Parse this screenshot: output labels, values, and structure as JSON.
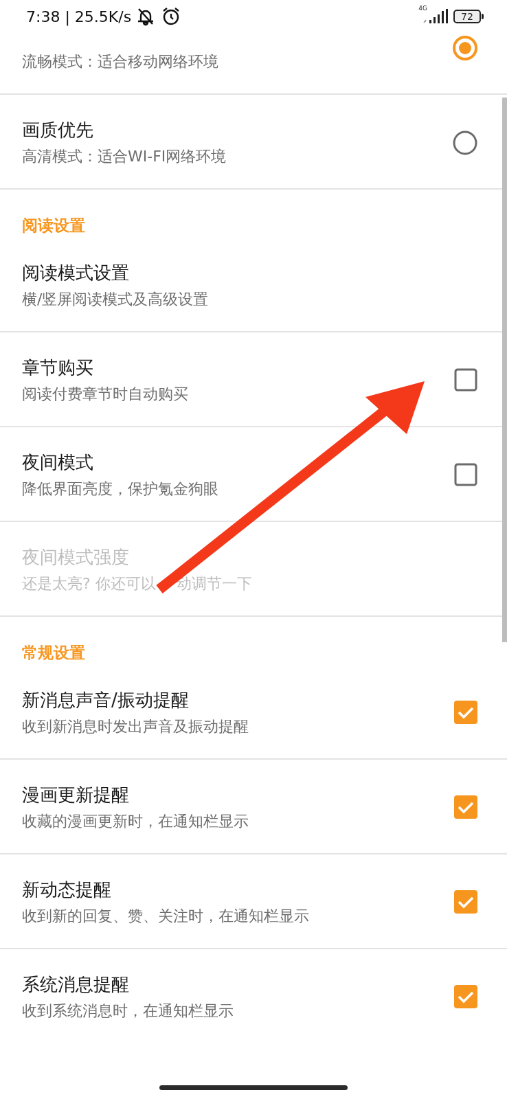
{
  "status_bar": {
    "time": "7:38 | 25.5K/s",
    "network": "4G",
    "battery": "72"
  },
  "sections": [
    {
      "items": [
        {
          "kind": "radio",
          "subtitle": "流畅模式：适合移动网络环境",
          "selected": true,
          "disabled": false
        },
        {
          "kind": "radio",
          "title": "画质优先",
          "subtitle": "高清模式：适合WI-FI网络环境",
          "selected": false,
          "disabled": false
        }
      ]
    },
    {
      "header": "阅读设置",
      "items": [
        {
          "kind": "plain",
          "title": "阅读模式设置",
          "subtitle": "横/竖屏阅读模式及高级设置",
          "disabled": false
        },
        {
          "kind": "checkbox",
          "title": "章节购买",
          "subtitle": "阅读付费章节时自动购买",
          "checked": false,
          "disabled": false
        },
        {
          "kind": "checkbox",
          "title": "夜间模式",
          "subtitle": "降低界面亮度，保护氪金狗眼",
          "checked": false,
          "disabled": false
        },
        {
          "kind": "plain",
          "title": "夜间模式强度",
          "subtitle": "还是太亮? 你还可以",
          "subtitle_after_arrow": "动调节一下",
          "disabled": true
        }
      ]
    },
    {
      "header": "常规设置",
      "items": [
        {
          "kind": "checkbox",
          "title": "新消息声音/振动提醒",
          "subtitle": "收到新消息时发出声音及振动提醒",
          "checked": true,
          "disabled": false
        },
        {
          "kind": "checkbox",
          "title": "漫画更新提醒",
          "subtitle": "收藏的漫画更新时，在通知栏显示",
          "checked": true,
          "disabled": false
        },
        {
          "kind": "checkbox",
          "title": "新动态提醒",
          "subtitle": "收到新的回复、赞、关注时，在通知栏显示",
          "checked": true,
          "disabled": false
        },
        {
          "kind": "checkbox",
          "title": "系统消息提醒",
          "subtitle": "收到系统消息时，在通知栏显示",
          "checked": true,
          "disabled": false
        }
      ]
    }
  ],
  "annotation": {
    "kind": "arrow"
  }
}
